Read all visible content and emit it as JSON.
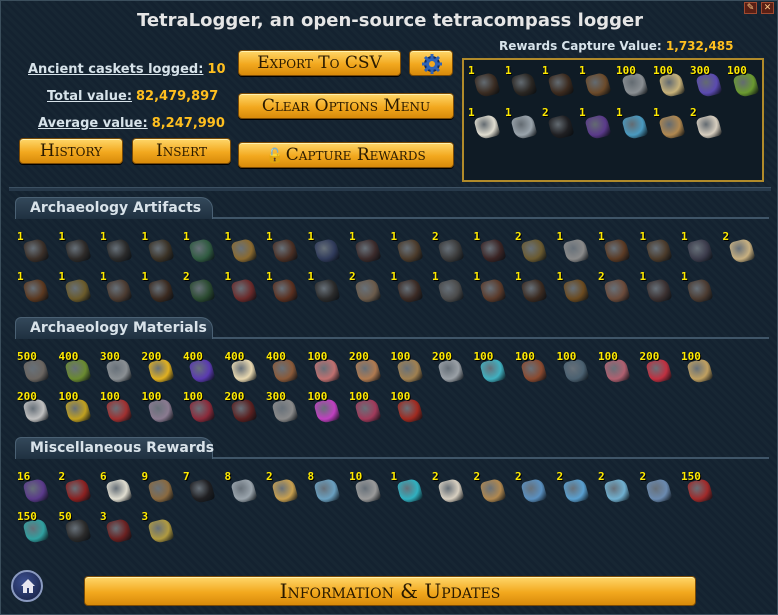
{
  "app": {
    "title": "TetraLogger, an open-source tetracompass logger"
  },
  "stats": {
    "caskets_label": "Ancient caskets logged:",
    "caskets_value": "10",
    "total_label": "Total value:",
    "total_value": "82,479,897",
    "average_label": "Average value:",
    "average_value": "8,247,990"
  },
  "buttons": {
    "export": "Export To CSV",
    "clear": "Clear Options Menu",
    "history": "History",
    "insert": "Insert",
    "capture": "Capture Rewards",
    "info": "Information & Updates"
  },
  "capture": {
    "label": "Rewards Capture Value:",
    "value": "1,732,485",
    "items": [
      {
        "q": "1",
        "c": "#3a2c22"
      },
      {
        "q": "1",
        "c": "#2a2622"
      },
      {
        "q": "1",
        "c": "#3b2a1e"
      },
      {
        "q": "1",
        "c": "#6b4a2a"
      },
      {
        "q": "100",
        "c": "#8a8f93"
      },
      {
        "q": "100",
        "c": "#c7b27a"
      },
      {
        "q": "300",
        "c": "#5b4ab0"
      },
      {
        "q": "100",
        "c": "#6a9a30"
      },
      {
        "q": "1",
        "c": "#e0ddd0"
      },
      {
        "q": "1",
        "c": "#9aa4ac"
      },
      {
        "q": "2",
        "c": "#1f1f22"
      },
      {
        "q": "1",
        "c": "#5a3a8a"
      },
      {
        "q": "1",
        "c": "#4a9ac0"
      },
      {
        "q": "1",
        "c": "#b08850"
      },
      {
        "q": "2",
        "c": "#d8cfc0"
      }
    ]
  },
  "sections": {
    "artifacts": {
      "title": "Archaeology Artifacts",
      "items": [
        {
          "q": "1",
          "c": "#3a2f28"
        },
        {
          "q": "1",
          "c": "#2d2a28"
        },
        {
          "q": "1",
          "c": "#2a2a2a"
        },
        {
          "q": "1",
          "c": "#3a3226"
        },
        {
          "q": "1",
          "c": "#2f5a40"
        },
        {
          "q": "1",
          "c": "#8a6a30"
        },
        {
          "q": "1",
          "c": "#4a2f24"
        },
        {
          "q": "1",
          "c": "#2f3a5a"
        },
        {
          "q": "1",
          "c": "#3a2a2a"
        },
        {
          "q": "1",
          "c": "#4a3a2a"
        },
        {
          "q": "2",
          "c": "#3a3a3a"
        },
        {
          "q": "1",
          "c": "#3a2424"
        },
        {
          "q": "2",
          "c": "#6a5a30"
        },
        {
          "q": "1",
          "c": "#8a8a8a"
        },
        {
          "q": "1",
          "c": "#5a3a24"
        },
        {
          "q": "1",
          "c": "#4a3a2a"
        },
        {
          "q": "1",
          "c": "#3a3a4a"
        },
        {
          "q": "2",
          "c": "#c8b080"
        },
        {
          "q": "1",
          "c": "#5a3820"
        },
        {
          "q": "1",
          "c": "#6a5a2a"
        },
        {
          "q": "1",
          "c": "#4a3a30"
        },
        {
          "q": "1",
          "c": "#3a2a20"
        },
        {
          "q": "2",
          "c": "#2a4a30"
        },
        {
          "q": "1",
          "c": "#6a2a2a"
        },
        {
          "q": "1",
          "c": "#5a3020"
        },
        {
          "q": "1",
          "c": "#2a2a2a"
        },
        {
          "q": "2",
          "c": "#6a5a4a"
        },
        {
          "q": "1",
          "c": "#3a2a24"
        },
        {
          "q": "1",
          "c": "#4a4a4a"
        },
        {
          "q": "1",
          "c": "#5a3a2a"
        },
        {
          "q": "1",
          "c": "#3a2a20"
        },
        {
          "q": "1",
          "c": "#6a4a20"
        },
        {
          "q": "2",
          "c": "#6a4a3a"
        },
        {
          "q": "1",
          "c": "#3a3030"
        },
        {
          "q": "1",
          "c": "#4a3a30"
        }
      ]
    },
    "materials": {
      "title": "Archaeology Materials",
      "items": [
        {
          "q": "500",
          "c": "#6a6560"
        },
        {
          "q": "400",
          "c": "#6a8a30"
        },
        {
          "q": "300",
          "c": "#8a8f93"
        },
        {
          "q": "200",
          "c": "#e0b020"
        },
        {
          "q": "400",
          "c": "#5a3ab0"
        },
        {
          "q": "400",
          "c": "#e8d8b0"
        },
        {
          "q": "400",
          "c": "#8a5a3a"
        },
        {
          "q": "100",
          "c": "#c07070"
        },
        {
          "q": "200",
          "c": "#b07a50"
        },
        {
          "q": "100",
          "c": "#a08050"
        },
        {
          "q": "200",
          "c": "#9aa0a6"
        },
        {
          "q": "100",
          "c": "#40b0c0"
        },
        {
          "q": "100",
          "c": "#8a4a30"
        },
        {
          "q": "100",
          "c": "#4a6070"
        },
        {
          "q": "100",
          "c": "#b06070"
        },
        {
          "q": "200",
          "c": "#c03040"
        },
        {
          "q": "100",
          "c": "#c0a060"
        },
        {
          "q": "200",
          "c": "#c0c0c0"
        },
        {
          "q": "100",
          "c": "#c0a020"
        },
        {
          "q": "100",
          "c": "#a03030"
        },
        {
          "q": "100",
          "c": "#8a7a90"
        },
        {
          "q": "100",
          "c": "#8a2a3a"
        },
        {
          "q": "200",
          "c": "#5a2020"
        },
        {
          "q": "300",
          "c": "#8a8a8a"
        },
        {
          "q": "100",
          "c": "#c040c0"
        },
        {
          "q": "100",
          "c": "#a03a5a"
        },
        {
          "q": "100",
          "c": "#a02a20"
        }
      ]
    },
    "misc": {
      "title": "Miscellaneous Rewards",
      "items": [
        {
          "q": "16",
          "c": "#5a3a8a"
        },
        {
          "q": "2",
          "c": "#8a2020"
        },
        {
          "q": "6",
          "c": "#e0ddd0"
        },
        {
          "q": "9",
          "c": "#8a6a40"
        },
        {
          "q": "7",
          "c": "#1f1f22"
        },
        {
          "q": "8",
          "c": "#9aa4ac"
        },
        {
          "q": "2",
          "c": "#c8a050"
        },
        {
          "q": "8",
          "c": "#6aa0c0"
        },
        {
          "q": "10",
          "c": "#9a9a9a"
        },
        {
          "q": "1",
          "c": "#30b0c0"
        },
        {
          "q": "2",
          "c": "#d8cfc0"
        },
        {
          "q": "2",
          "c": "#b08850"
        },
        {
          "q": "2",
          "c": "#5a90c0"
        },
        {
          "q": "2",
          "c": "#5aa0d0"
        },
        {
          "q": "2",
          "c": "#70b0d0"
        },
        {
          "q": "2",
          "c": "#6a8ab0"
        },
        {
          "q": "150",
          "c": "#a02a2a"
        },
        {
          "q": "150",
          "c": "#30a0a0"
        },
        {
          "q": "50",
          "c": "#2a2a2a"
        },
        {
          "q": "3",
          "c": "#6a2020"
        },
        {
          "q": "3",
          "c": "#b09a40"
        }
      ]
    }
  },
  "colors": {
    "accent": "#ffbf1f",
    "qty": "#ffea00",
    "button": "#f2a81e",
    "background": "#172633"
  },
  "icons": {
    "settings": "gear-icon",
    "home": "home-icon",
    "lock": "lock-icon"
  }
}
